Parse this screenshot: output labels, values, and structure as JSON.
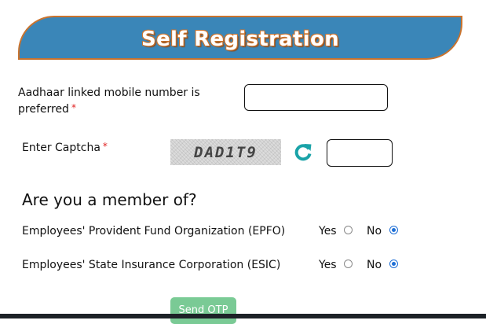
{
  "header": {
    "title": "Self Registration"
  },
  "mobile": {
    "label": "Aadhaar linked mobile number is preferred",
    "required_mark": "*",
    "value": ""
  },
  "captcha": {
    "label": "Enter Captcha",
    "required_mark": "*",
    "code": "DAD1T9",
    "value": ""
  },
  "membership": {
    "title": "Are you a member of?",
    "yes_label": "Yes",
    "no_label": "No",
    "questions": [
      {
        "label": "Employees' Provident Fund Organization (EPFO)",
        "selected": "No"
      },
      {
        "label": "Employees' State Insurance Corporation (ESIC)",
        "selected": "No"
      }
    ]
  },
  "actions": {
    "send_otp_label": "Send OTP"
  },
  "colors": {
    "banner": "#3a86b8",
    "banner_border": "#c9732e",
    "refresh_icon": "#1aa3a8",
    "button": "#6cc58a",
    "radio_checked": "#1f6fd6"
  }
}
